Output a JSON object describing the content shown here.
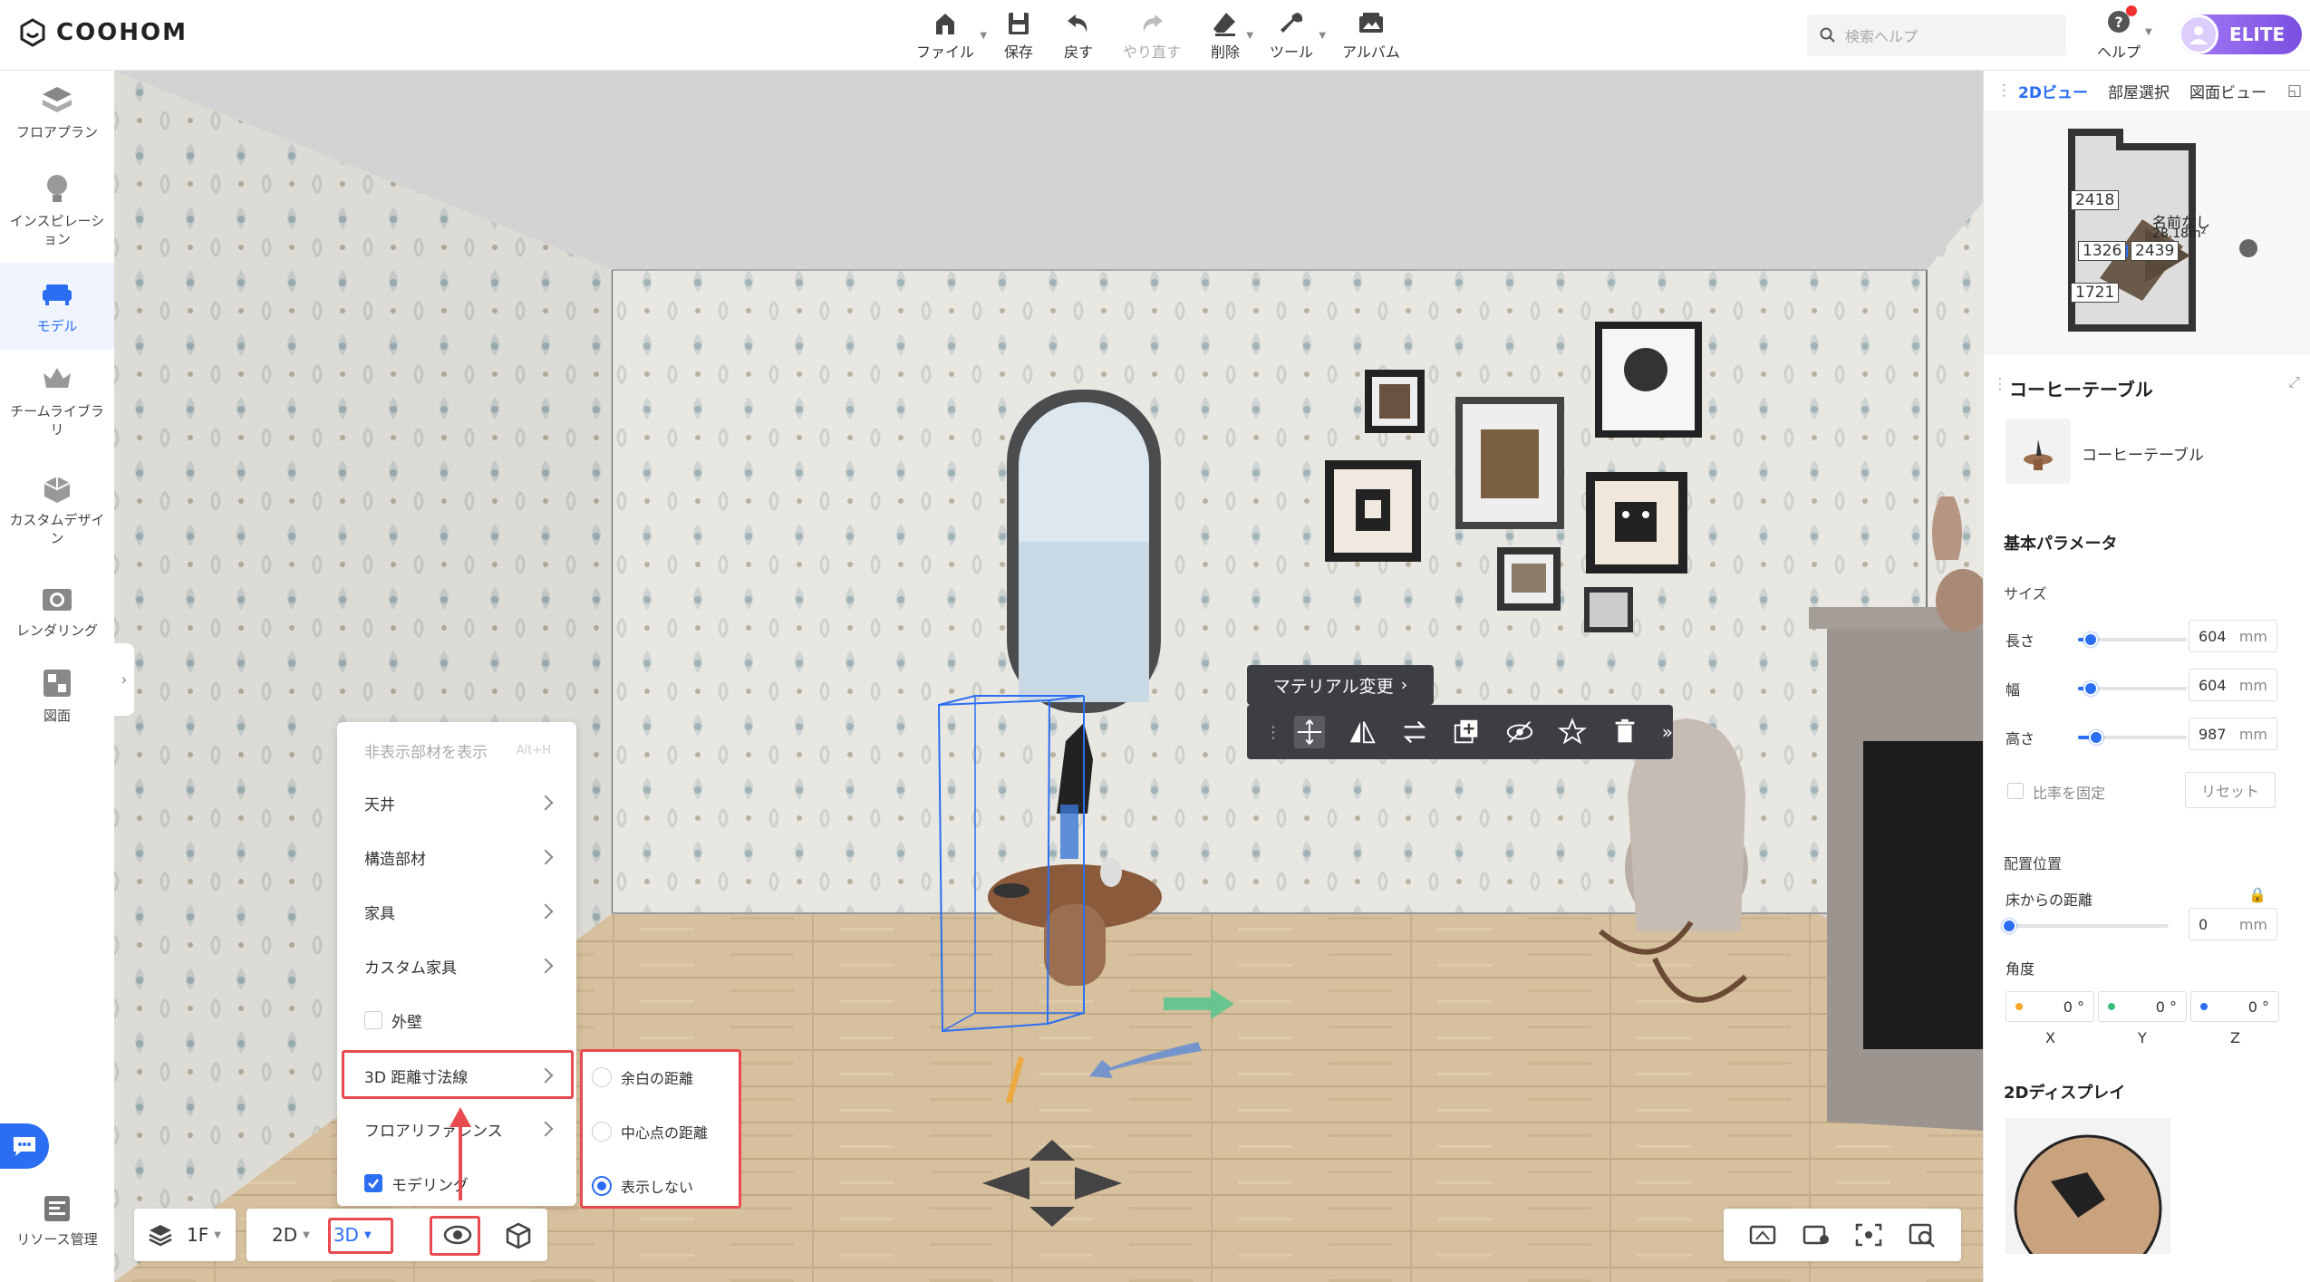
{
  "app": {
    "logo_text": "COOHOM"
  },
  "toolbar": {
    "items": [
      {
        "label": "ファイル",
        "icon": "home-icon",
        "caret": true,
        "disabled": false
      },
      {
        "label": "保存",
        "icon": "save-icon",
        "caret": false,
        "disabled": false
      },
      {
        "label": "戻す",
        "icon": "undo-icon",
        "caret": false,
        "disabled": false
      },
      {
        "label": "やり直す",
        "icon": "redo-icon",
        "caret": false,
        "disabled": true
      },
      {
        "label": "削除",
        "icon": "eraser-icon",
        "caret": true,
        "disabled": false
      },
      {
        "label": "ツール",
        "icon": "wrench-icon",
        "caret": true,
        "disabled": false
      },
      {
        "label": "アルバム",
        "icon": "album-icon",
        "caret": false,
        "disabled": false
      }
    ]
  },
  "search": {
    "placeholder": "検索ヘルプ"
  },
  "help": {
    "label": "ヘルプ"
  },
  "account": {
    "badge": "ELITE"
  },
  "sidebar": {
    "items": [
      {
        "label": "フロアプラン",
        "icon": "floorplan-icon"
      },
      {
        "label": "インスピレーション",
        "icon": "bulb-icon"
      },
      {
        "label": "モデル",
        "icon": "sofa-icon",
        "active": true
      },
      {
        "label": "チームライブラリ",
        "icon": "crown-icon"
      },
      {
        "label": "カスタムデザイン",
        "icon": "custom-box-icon"
      },
      {
        "label": "レンダリング",
        "icon": "camera-icon"
      },
      {
        "label": "図面",
        "icon": "drawing-icon"
      }
    ],
    "bottom": {
      "label": "リソース管理",
      "icon": "resource-icon"
    }
  },
  "right_panel": {
    "tabs": [
      "2Dビュー",
      "部屋選択",
      "図面ビュー"
    ],
    "active_tab": "2Dビュー",
    "minimap": {
      "dims": [
        "2418",
        "1326",
        "2439",
        "1721"
      ],
      "room_label": "名前なし",
      "room_area": "28.18m²"
    },
    "properties": {
      "header": "コーヒーテーブル",
      "item_name": "コーヒーテーブル",
      "basic_params": "基本パラメータ",
      "size_section": "サイズ",
      "length_label": "長さ",
      "length_value": "604",
      "width_label": "幅",
      "width_value": "604",
      "height_label": "高さ",
      "height_value": "987",
      "unit": "mm",
      "lock_ratio": "比率を固定",
      "reset": "リセット",
      "placement": "配置位置",
      "floor_distance_label": "床からの距離",
      "floor_distance_value": "0",
      "angle_label": "角度",
      "angles": [
        {
          "axis": "X",
          "value": "0",
          "color": "#f5a623"
        },
        {
          "axis": "Y",
          "value": "0",
          "color": "#3dbd7d"
        },
        {
          "axis": "Z",
          "value": "0",
          "color": "#2b6ef2"
        }
      ],
      "degree": "°",
      "display2d": "2Dディスプレイ"
    }
  },
  "selection_toolbar": {
    "material_change": "マテリアル変更"
  },
  "view_menu": {
    "header": "非表示部材を表示",
    "header_shortcut": "Alt+H",
    "items": [
      "天井",
      "構造部材",
      "家具",
      "カスタム家具"
    ],
    "exterior_wall": "外壁",
    "dim_lines": "3D 距離寸法線",
    "floor_reference": "フロアリファレンス",
    "modeling": "モデリング"
  },
  "dim_submenu": {
    "options": [
      "余白の距離",
      "中心点の距離",
      "表示しない"
    ],
    "selected": "表示しない"
  },
  "bottom_bar": {
    "floor": "1F",
    "mode2d": "2D",
    "mode3d": "3D"
  },
  "colors": {
    "accent": "#2b6ef2",
    "highlight": "#e84a4f",
    "toolbar_dark": "#3d3e44"
  }
}
